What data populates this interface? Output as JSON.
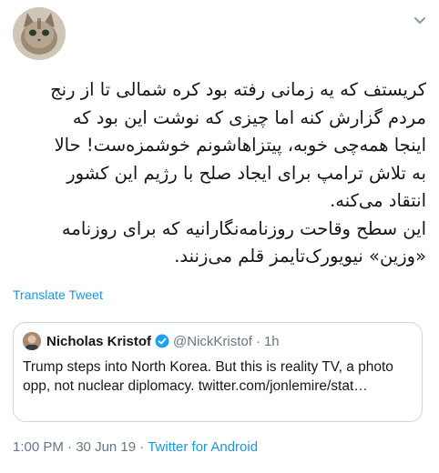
{
  "tweet": {
    "lines": [
      "کریستف که یه زمانی رفته بود کره شمالی تا از رنج",
      "مردم گزارش کنه اما چیزی که نوشت این بود که",
      "اینجا همه‌چی خوبه، پیتزاهاشونم خوشمزه‌ست! حالا",
      "به تلاش ترامپ برای ایجاد صلح با رژیم این کشور",
      "انتقاد می‌کنه.",
      "این سطح وقاحت روزنامه‌نگارانیه که برای روزنامه",
      "«وزین» نیویورک‌تایمز قلم می‌زنند."
    ],
    "translate_label": "Translate Tweet",
    "time": "1:00 PM",
    "separator": "·",
    "date": "30 Jun 19",
    "source": "Twitter for Android"
  },
  "quoted": {
    "name": "Nicholas Kristof",
    "handle": "@NickKristof",
    "separator": "·",
    "time": "1h",
    "text": "Trump steps into North Korea.  But this is reality TV, a photo opp, not nuclear diplomacy. twitter.com/jonlemire/stat…"
  },
  "colors": {
    "accent": "#1b95e0",
    "secondary_text": "#657786",
    "border": "#ccd6dd"
  },
  "icons": {
    "menu": "chevron-down-icon",
    "verified": "verified-badge-icon"
  }
}
